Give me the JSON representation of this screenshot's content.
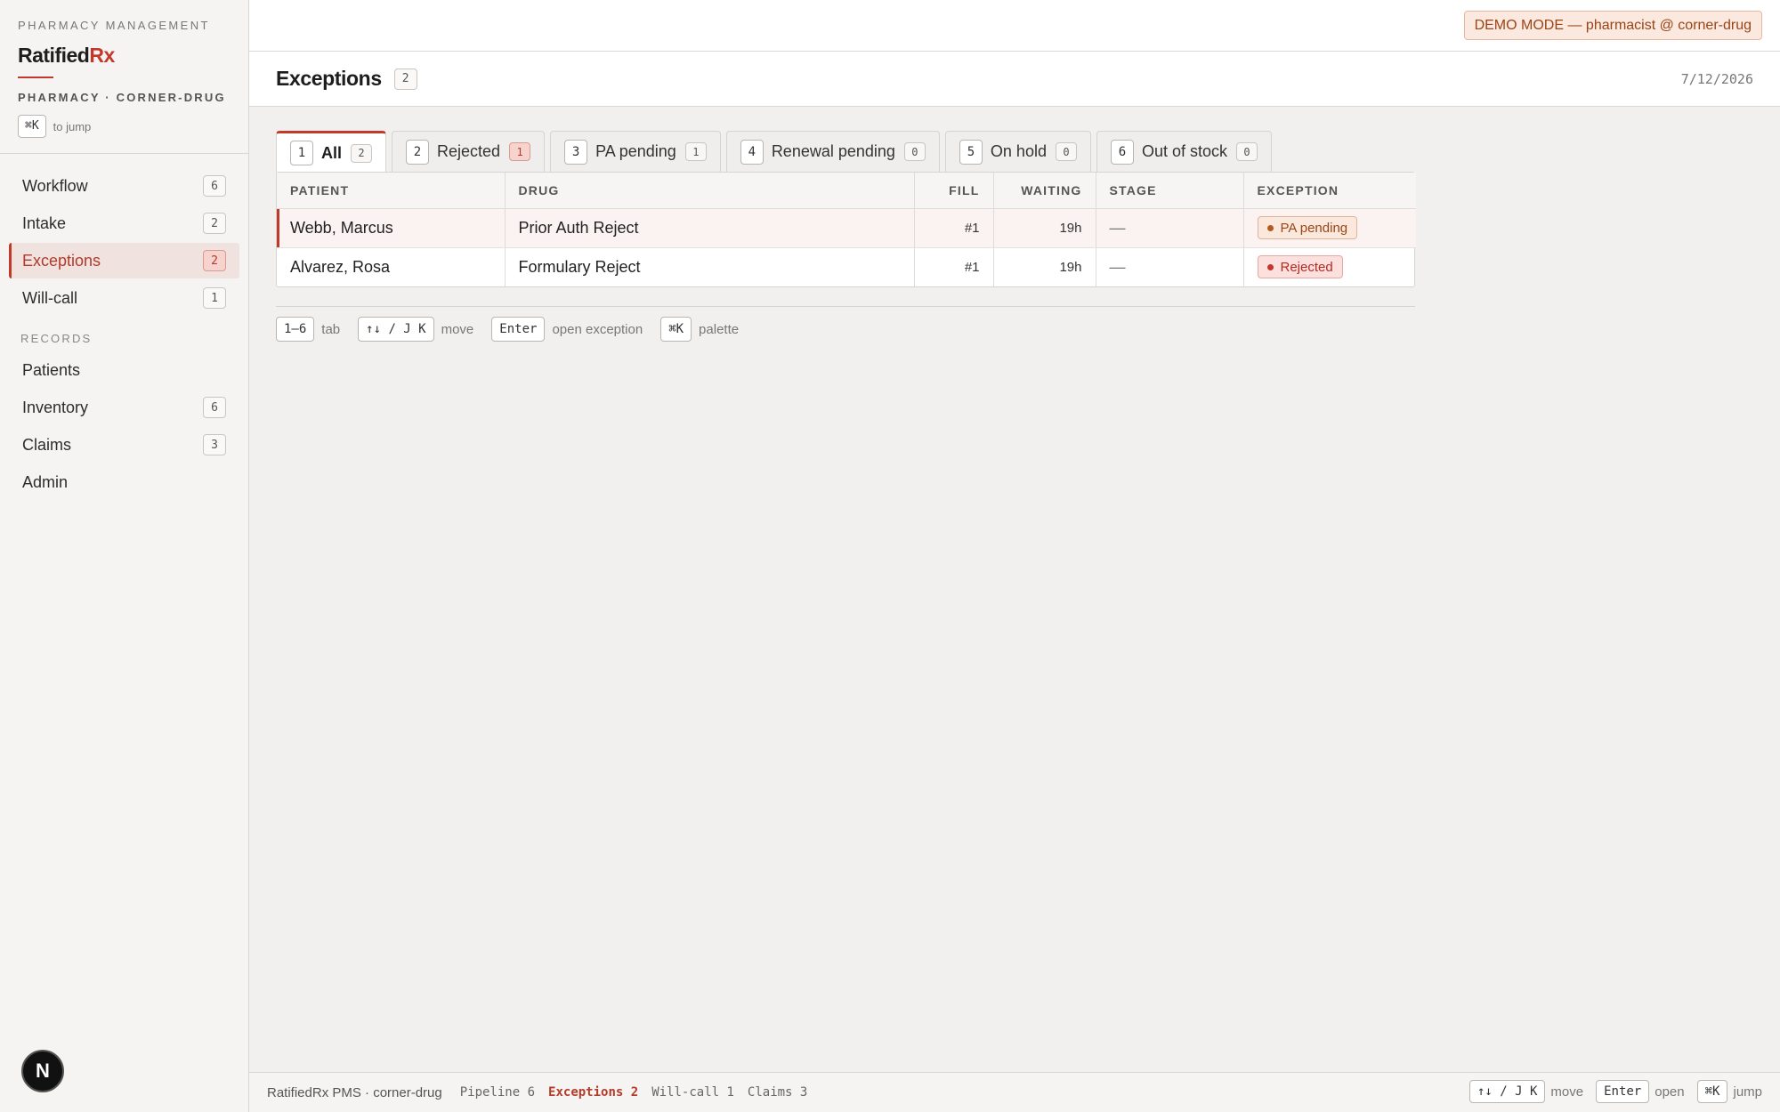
{
  "brand": {
    "kicker": "PHARMACY MANAGEMENT",
    "name_main": "Ratified",
    "name_accent": "Rx",
    "pharmacy": "PHARMACY · CORNER-DRUG",
    "jump_key": "⌘K",
    "jump_hint": "to jump"
  },
  "sidebar": {
    "items": [
      {
        "label": "Workflow",
        "count": "6"
      },
      {
        "label": "Intake",
        "count": "2"
      },
      {
        "label": "Exceptions",
        "count": "2"
      },
      {
        "label": "Will-call",
        "count": "1"
      }
    ],
    "records_heading": "RECORDS",
    "records": [
      {
        "label": "Patients"
      },
      {
        "label": "Inventory",
        "count": "6"
      },
      {
        "label": "Claims",
        "count": "3"
      },
      {
        "label": "Admin"
      }
    ],
    "avatar_letter": "N"
  },
  "topbar": {
    "demo_badge": "DEMO MODE — pharmacist @ corner-drug"
  },
  "header": {
    "title": "Exceptions",
    "count": "2",
    "date": "7/12/2026"
  },
  "tabs": [
    {
      "num": "1",
      "label": "All",
      "count": "2"
    },
    {
      "num": "2",
      "label": "Rejected",
      "count": "1"
    },
    {
      "num": "3",
      "label": "PA pending",
      "count": "1"
    },
    {
      "num": "4",
      "label": "Renewal pending",
      "count": "0"
    },
    {
      "num": "5",
      "label": "On hold",
      "count": "0"
    },
    {
      "num": "6",
      "label": "Out of stock",
      "count": "0"
    }
  ],
  "table": {
    "columns": [
      "PATIENT",
      "DRUG",
      "FILL",
      "WAITING",
      "STAGE",
      "EXCEPTION"
    ],
    "rows": [
      {
        "patient": "Webb, Marcus",
        "drug": "Prior Auth Reject",
        "fill": "#1",
        "waiting": "19h",
        "stage": "—",
        "exception": "PA pending"
      },
      {
        "patient": "Alvarez, Rosa",
        "drug": "Formulary Reject",
        "fill": "#1",
        "waiting": "19h",
        "stage": "—",
        "exception": "Rejected"
      }
    ]
  },
  "shortcuts": [
    {
      "key": "1–6",
      "label": "tab"
    },
    {
      "key": "↑↓ / J K",
      "label": "move"
    },
    {
      "key": "Enter",
      "label": "open exception"
    },
    {
      "key": "⌘K",
      "label": "palette"
    }
  ],
  "statusbar": {
    "app": "RatifiedRx PMS · corner-drug",
    "items": [
      "Pipeline 6",
      "Exceptions 2",
      "Will-call 1",
      "Claims 3"
    ],
    "right": [
      {
        "key": "↑↓ / J K",
        "label": "move"
      },
      {
        "key": "Enter",
        "label": "open"
      },
      {
        "key": "⌘K",
        "label": "jump"
      }
    ]
  },
  "colors": {
    "accent": "#c0392b",
    "pa_pending": "#9a4417",
    "rejected": "#b42a20"
  }
}
